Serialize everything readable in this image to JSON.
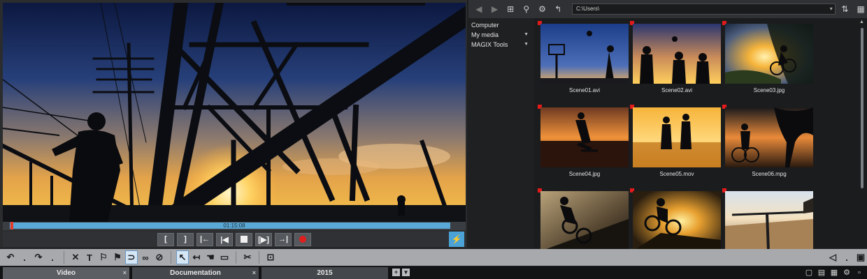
{
  "preview": {
    "timecode": "01:15:08",
    "transport": [
      {
        "name": "set-in-button",
        "label": "["
      },
      {
        "name": "set-out-button",
        "label": "]"
      },
      {
        "name": "jump-start-button",
        "label": "|←"
      },
      {
        "name": "prev-marker-button",
        "label": "|◀"
      },
      {
        "name": "stop-button",
        "label": ""
      },
      {
        "name": "play-button",
        "label": "[▶]"
      },
      {
        "name": "jump-end-button",
        "label": "→|"
      },
      {
        "name": "record-button",
        "label": ""
      }
    ],
    "bolt_label": "⚡"
  },
  "pool": {
    "path": "C:\\Users\\",
    "tree": [
      {
        "label": "Computer",
        "arrow": ""
      },
      {
        "label": "My media",
        "arrow": "▼"
      },
      {
        "label": "MAGIX Tools",
        "arrow": "▼"
      }
    ],
    "files": [
      {
        "name": "Scene01.avi",
        "theme": "basket"
      },
      {
        "name": "Scene02.avi",
        "theme": "trio"
      },
      {
        "name": "Scene03.jpg",
        "theme": "bike-sun"
      },
      {
        "name": "Scene04.jpg",
        "theme": "skater"
      },
      {
        "name": "Scene05.mov",
        "theme": "beach"
      },
      {
        "name": "Scene06.mpg",
        "theme": "cyclist"
      },
      {
        "name": "",
        "theme": "bmx1"
      },
      {
        "name": "",
        "theme": "bmx2"
      },
      {
        "name": "",
        "theme": "handlebar"
      }
    ]
  },
  "toolbar": {
    "undo": "↶",
    "redo": "↷",
    "delete": "✕",
    "text": "T",
    "mute": "🔇",
    "screen": "▣"
  },
  "tabs": [
    {
      "label": "Video",
      "close": "×"
    },
    {
      "label": "Documentation",
      "close": "×"
    },
    {
      "label": "2015",
      "close": ""
    }
  ],
  "tab_add": "+",
  "tab_menu": "▾",
  "colors": {
    "accent": "#4ba2d6",
    "record": "#e01e1e",
    "marker": "#e21a1a"
  }
}
